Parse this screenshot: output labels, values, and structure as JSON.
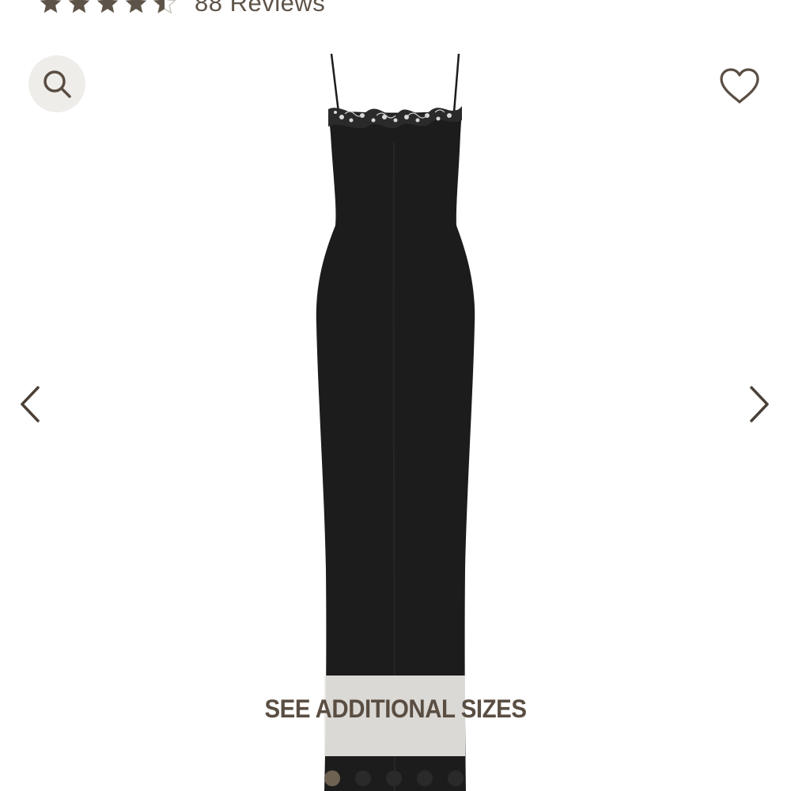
{
  "rating": {
    "stars": 4.5,
    "star_color": "#5e5348",
    "reviews_label": "88 Reviews"
  },
  "icons": {
    "search": "search-icon",
    "favorite": "heart-icon",
    "previous": "chevron-left-icon",
    "next": "chevron-right-icon"
  },
  "product": {
    "image_description_icon": "dress-image"
  },
  "sizes_button": {
    "label": "SEE ADDITIONAL SIZES"
  },
  "carousel": {
    "total_images": 5,
    "active_index": 0
  },
  "colors": {
    "accent": "#5e5348",
    "dress": "#1c1c1c",
    "search_bg": "#efedea"
  }
}
